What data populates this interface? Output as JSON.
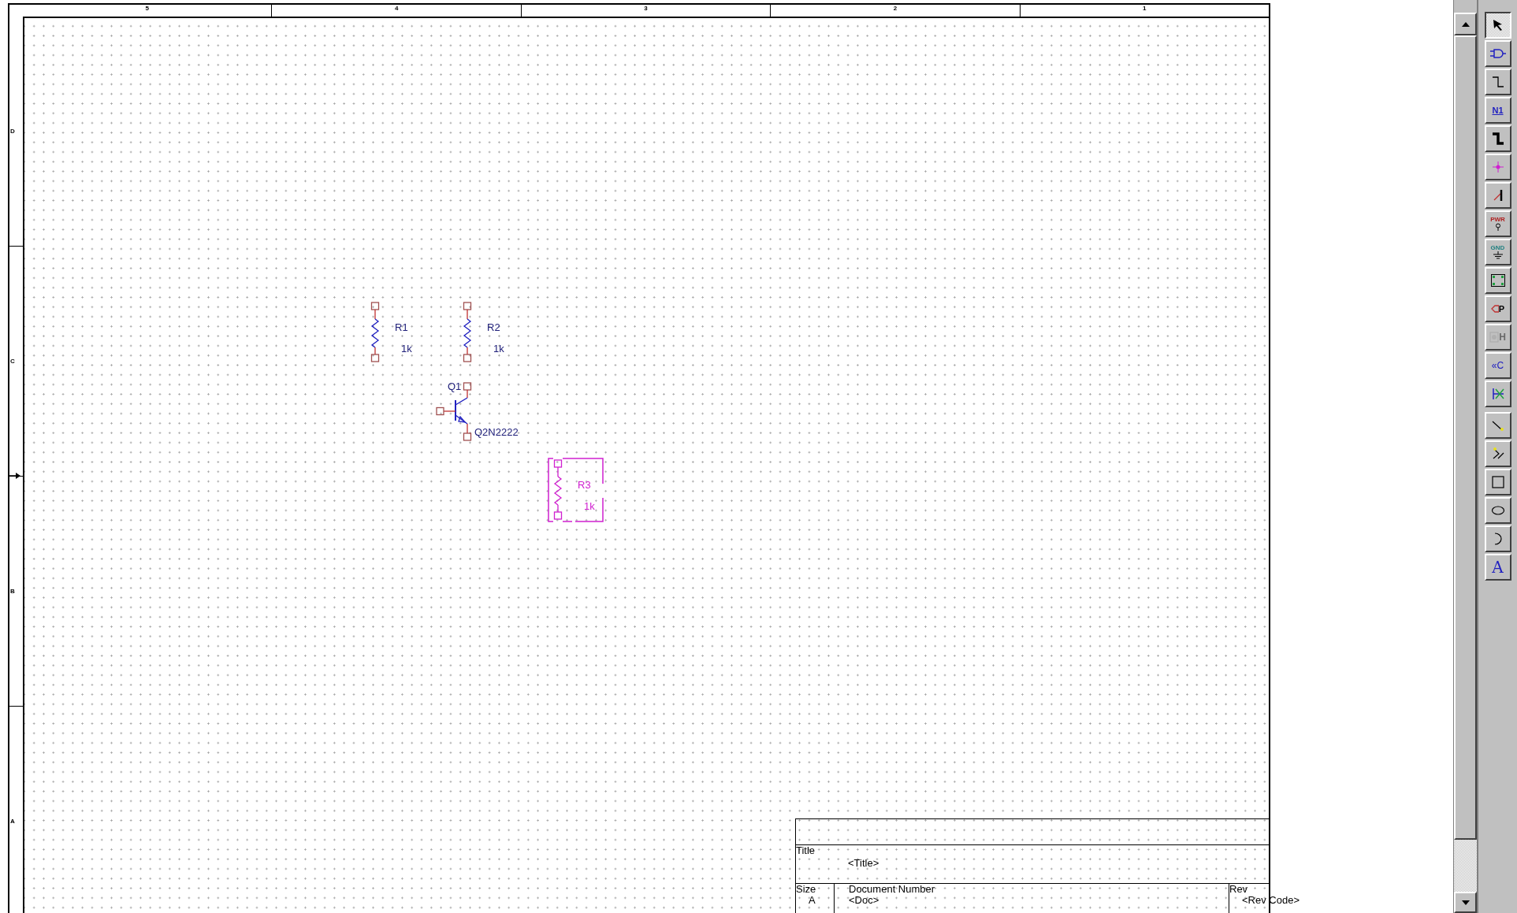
{
  "sheet": {
    "columns": [
      "5",
      "4",
      "3",
      "2",
      "1"
    ],
    "rows": [
      "D",
      "C",
      "B",
      "A"
    ]
  },
  "parts": [
    {
      "kind": "resistor",
      "reference": "R1",
      "value": "1k",
      "selected": false
    },
    {
      "kind": "resistor",
      "reference": "R2",
      "value": "1k",
      "selected": false
    },
    {
      "kind": "transistor",
      "reference": "Q1",
      "value": "Q2N2222",
      "selected": false
    },
    {
      "kind": "resistor",
      "reference": "R3",
      "value": "1k",
      "selected": true
    }
  ],
  "title_block": {
    "title_label": "Title",
    "title": "<Title>",
    "size_label": "Size",
    "size": "A",
    "document_label": "Document Number",
    "document": "<Doc>",
    "rev_label": "Rev",
    "rev": "<Rev Code>"
  },
  "toolbar": {
    "groups": [
      {
        "buttons": [
          {
            "kind": "pointer",
            "selected": true,
            "disabled": false
          },
          {
            "kind": "part",
            "selected": false,
            "disabled": false
          },
          {
            "kind": "wire",
            "selected": false,
            "disabled": false
          },
          {
            "kind": "net-alias",
            "label": "N1",
            "selected": false,
            "disabled": false
          },
          {
            "kind": "bus",
            "selected": false,
            "disabled": false
          },
          {
            "kind": "junction",
            "selected": false,
            "disabled": false
          },
          {
            "kind": "bus-entry",
            "selected": false,
            "disabled": false
          },
          {
            "kind": "power",
            "label": "PWR",
            "selected": false,
            "disabled": false
          },
          {
            "kind": "ground",
            "label": "GND",
            "selected": false,
            "disabled": false
          },
          {
            "kind": "block",
            "selected": false,
            "disabled": false
          },
          {
            "kind": "port",
            "label": "P",
            "selected": false,
            "disabled": false
          },
          {
            "kind": "pin",
            "label": "H",
            "selected": false,
            "disabled": true
          },
          {
            "kind": "offpage",
            "label": "«C",
            "selected": false,
            "disabled": false
          },
          {
            "kind": "no-connect",
            "selected": false,
            "disabled": false
          }
        ]
      },
      {
        "buttons": [
          {
            "kind": "line",
            "selected": false,
            "disabled": false
          },
          {
            "kind": "polyline",
            "selected": false,
            "disabled": false
          },
          {
            "kind": "rectangle",
            "selected": false,
            "disabled": false
          },
          {
            "kind": "ellipse",
            "selected": false,
            "disabled": false
          },
          {
            "kind": "arc",
            "selected": false,
            "disabled": false
          },
          {
            "kind": "text",
            "label": "A",
            "selected": false,
            "disabled": false
          }
        ]
      }
    ]
  }
}
